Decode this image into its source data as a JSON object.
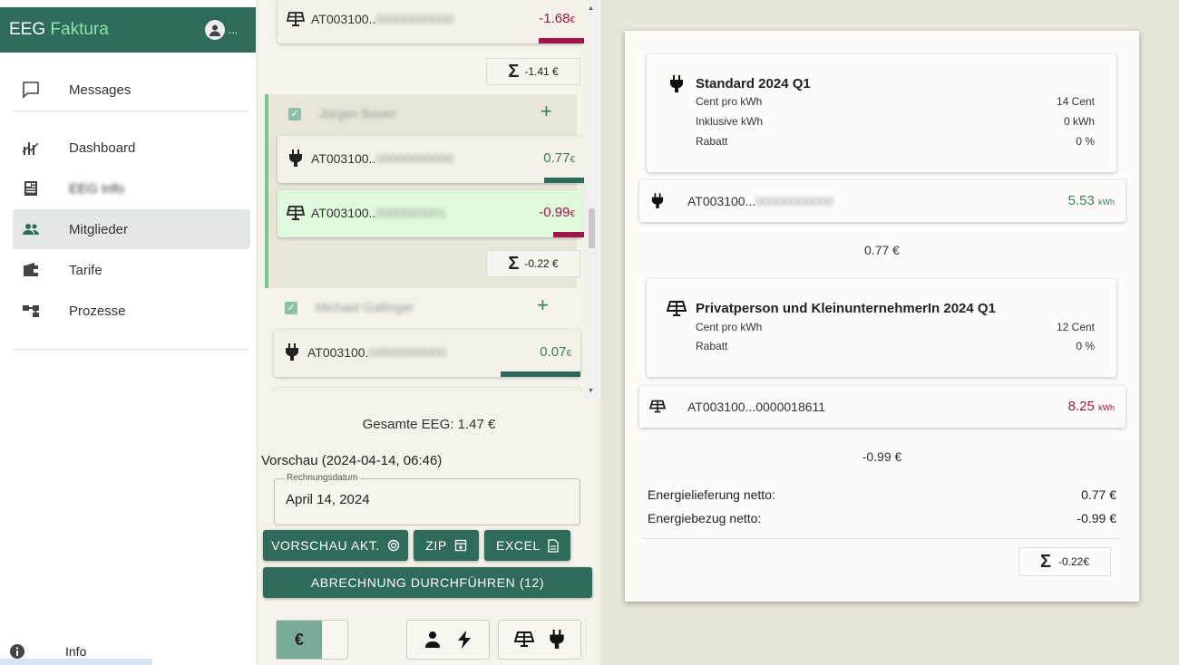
{
  "sidebar": {
    "title_part1": "EEG",
    "title_part2": "Faktura",
    "user_ellipsis": "...",
    "items": [
      {
        "label": "Messages",
        "icon": "message-icon"
      },
      {
        "label": "Dashboard",
        "icon": "chart-icon"
      },
      {
        "label": "EEG Info",
        "icon": "newspaper-icon"
      },
      {
        "label": "Mitglieder",
        "icon": "group-icon"
      },
      {
        "label": "Tarife",
        "icon": "wallet-icon"
      },
      {
        "label": "Prozesse",
        "icon": "flow-icon"
      }
    ],
    "info_label": "Info"
  },
  "middle": {
    "groups": [
      {
        "meters": [
          {
            "id_prefix": "AT003100..",
            "id_suffix": "00000000000",
            "amount": "-1.68",
            "currency": "€",
            "type": "producer",
            "fill": 0.15
          }
        ],
        "sum": "-1.41 €"
      },
      {
        "name": "Jürgen Bauer",
        "checked": true,
        "meters": [
          {
            "id_prefix": "AT003100..",
            "id_suffix": "00000000000",
            "amount": "0.77",
            "currency": "€",
            "type": "consumer",
            "fill": 0.13
          },
          {
            "id_prefix": "AT003100..",
            "id_suffix": "0000000001",
            "amount": "-0.99",
            "currency": "€",
            "type": "producer",
            "fill": 0.1
          }
        ],
        "sum": "-0.22 €"
      },
      {
        "name": "Michael Gallinger",
        "checked": true,
        "meters": [
          {
            "id_prefix": "AT003100.",
            "id_suffix": "00000000000",
            "amount": "0.07",
            "currency": "€",
            "type": "consumer",
            "fill": 0.26
          }
        ]
      }
    ],
    "total_label": "Gesamte EEG: 1.47 €",
    "preview_label": "Vorschau (2024-04-14, 06:46)",
    "date_field": {
      "label": "Rechnungsdatum",
      "value": "April 14, 2024"
    },
    "buttons": {
      "preview_refresh": "VORSCHAU AKT.",
      "zip": "ZIP",
      "excel": "EXCEL",
      "execute": "ABRECHNUNG DURCHFÜHREN (12)"
    },
    "toggle_symbol": "€"
  },
  "right": {
    "tariffs": [
      {
        "name": "Standard 2024 Q1",
        "icon": "plug-icon",
        "rows": [
          {
            "label": "Cent pro kWh",
            "value": "14 Cent"
          },
          {
            "label": "Inklusive kWh",
            "value": "0 kWh"
          },
          {
            "label": "Rabatt",
            "value": "0 %"
          }
        ]
      },
      {
        "name": "Privatperson und KleinunternehmerIn 2024 Q1",
        "icon": "solar-panel-icon",
        "rows": [
          {
            "label": "Cent pro kWh",
            "value": "12 Cent"
          },
          {
            "label": "Rabatt",
            "value": "0 %"
          }
        ]
      }
    ],
    "meters": [
      {
        "id_prefix": "AT003100...",
        "id_suffix": "00000000000",
        "kwh": "5.53",
        "unit": "kWh",
        "type": "consumer"
      },
      {
        "id_prefix": "AT003100...0000018611",
        "id_suffix": "",
        "kwh": "8.25",
        "unit": "kWh",
        "type": "producer"
      }
    ],
    "amounts": [
      "0.77 €",
      "-0.99 €"
    ],
    "net_lines": [
      {
        "label": "Energielieferung netto:",
        "value": "0.77 €"
      },
      {
        "label": "Energiebezug netto:",
        "value": "-0.99 €"
      }
    ],
    "sum": "-0.22€"
  },
  "colors": {
    "primary": "#2e6b5a",
    "negative": "#a0154a",
    "positive": "#3a7d5c",
    "highlight": "#e0f9dc"
  }
}
